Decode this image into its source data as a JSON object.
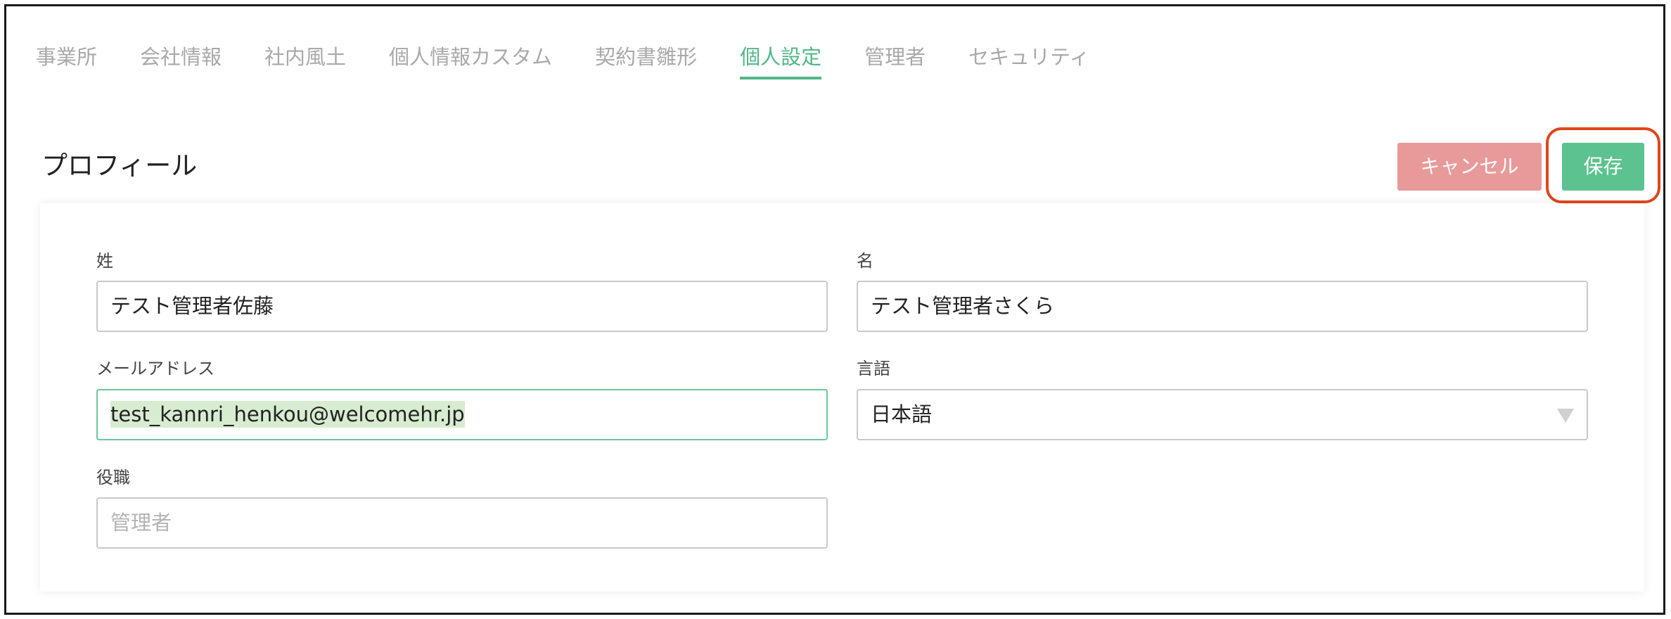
{
  "tabs": [
    {
      "label": "事業所",
      "active": false
    },
    {
      "label": "会社情報",
      "active": false
    },
    {
      "label": "社内風土",
      "active": false
    },
    {
      "label": "個人情報カスタム",
      "active": false
    },
    {
      "label": "契約書雛形",
      "active": false
    },
    {
      "label": "個人設定",
      "active": true
    },
    {
      "label": "管理者",
      "active": false
    },
    {
      "label": "セキュリティ",
      "active": false
    }
  ],
  "section": {
    "title": "プロフィール",
    "cancel_label": "キャンセル",
    "save_label": "保存"
  },
  "form": {
    "last_name": {
      "label": "姓",
      "value": "テスト管理者佐藤"
    },
    "first_name": {
      "label": "名",
      "value": "テスト管理者さくら"
    },
    "email": {
      "label": "メールアドレス",
      "value": "test_kannri_henkou@welcomehr.jp"
    },
    "language": {
      "label": "言語",
      "value": "日本語"
    },
    "position": {
      "label": "役職",
      "placeholder": "管理者"
    }
  },
  "colors": {
    "accent": "#52b788",
    "save_button": "#5cc28f",
    "cancel_button": "#e89a9a",
    "annotation": "#e0461c"
  }
}
